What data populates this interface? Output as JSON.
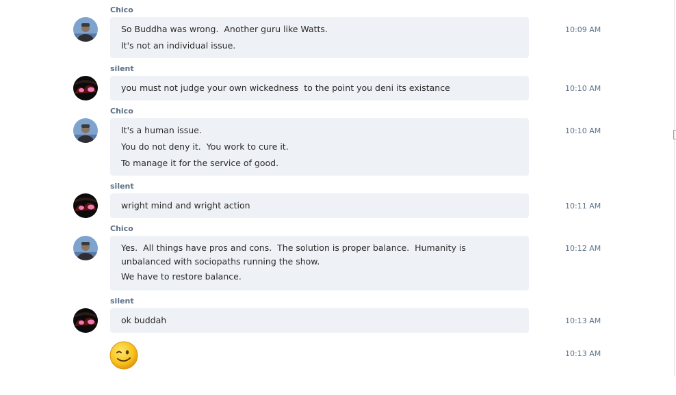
{
  "messages": [
    {
      "sender": "Chico",
      "avatar": "person-photo-avatar",
      "time": "10:09 AM",
      "lines": [
        "So Buddha was wrong.  Another guru like Watts.",
        "It's not an individual issue."
      ]
    },
    {
      "sender": "silent",
      "avatar": "anime-character-avatar",
      "time": "10:10 AM",
      "lines": [
        "you must not judge your own wickedness  to the point you deni its existance"
      ]
    },
    {
      "sender": "Chico",
      "avatar": "person-photo-avatar",
      "time": "10:10 AM",
      "lines": [
        "It's a human issue.",
        "You do not deny it.  You work to cure it.",
        "To manage it for the service of good."
      ]
    },
    {
      "sender": "silent",
      "avatar": "anime-character-avatar",
      "time": "10:11 AM",
      "lines": [
        "wright mind and wright action"
      ]
    },
    {
      "sender": "Chico",
      "avatar": "person-photo-avatar",
      "time": "10:12 AM",
      "lines": [
        "Yes.  All things have pros and cons.  The solution is proper balance.  Humanity is unbalanced with sociopaths running the show.",
        "We have to restore balance."
      ]
    },
    {
      "sender": "silent",
      "avatar": "anime-character-avatar",
      "time": "10:13 AM",
      "lines": [
        "ok buddah"
      ]
    }
  ],
  "emoji_message": {
    "icon": "winking-smiley-emoji-icon",
    "time": "10:13 AM"
  },
  "colors": {
    "bubble": "#eef1f6",
    "meta_text": "#5b6f87",
    "body_text": "#2a2a2a",
    "emoji_yellow": "#f7c21e"
  }
}
